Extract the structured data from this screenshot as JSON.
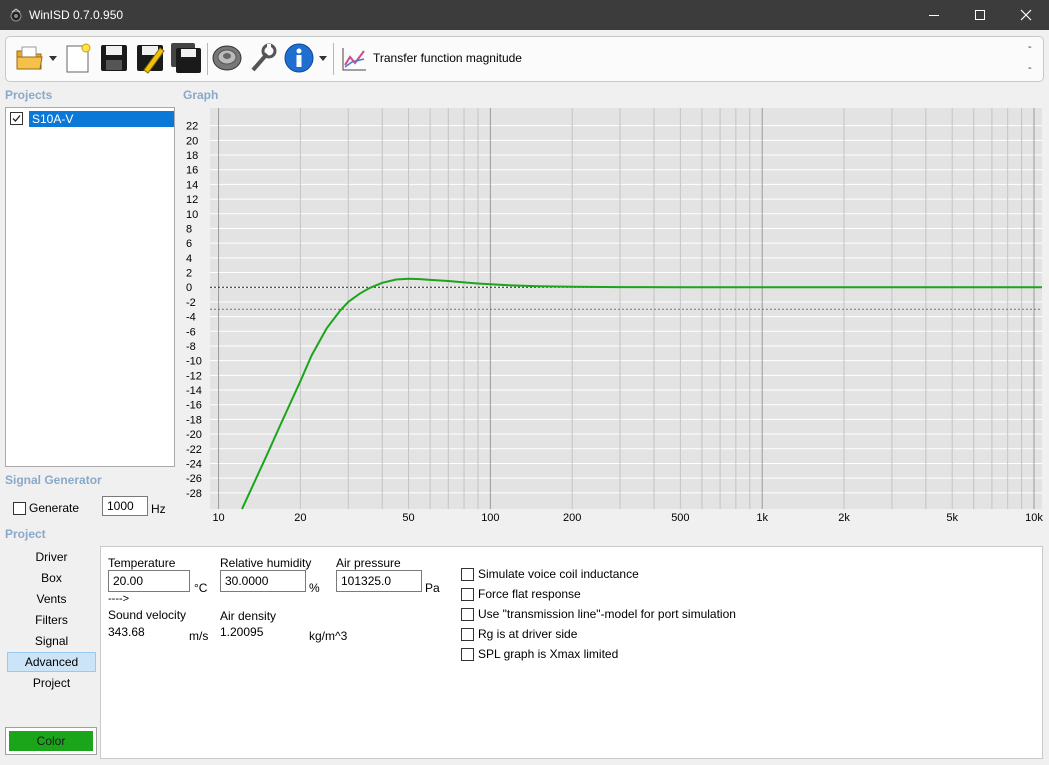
{
  "window": {
    "title": "WinISD 0.7.0.950"
  },
  "toolbar": {
    "icons": [
      "open-folder-icon",
      "new-document-icon",
      "save-icon",
      "edit-icon",
      "save-all-icon",
      "speaker-icon",
      "tools-icon",
      "info-icon"
    ],
    "graph_title": "Transfer function magnitude",
    "dash_top": "-",
    "dash_bottom": "-"
  },
  "projects": {
    "label": "Projects",
    "items": [
      {
        "name": "S10A-V",
        "checked": true
      }
    ]
  },
  "graph_label": "Graph",
  "signal_generator": {
    "label": "Signal Generator",
    "generate_label": "Generate",
    "frequency": "1000",
    "unit": "Hz"
  },
  "project_section": {
    "label": "Project",
    "nav": [
      "Driver",
      "Box",
      "Vents",
      "Filters",
      "Signal",
      "Advanced",
      "Project"
    ],
    "selected": "Advanced",
    "color_button": "Color",
    "color_swatch": "#1aa51a"
  },
  "advanced": {
    "temperature": {
      "label": "Temperature",
      "value": "20.00",
      "unit": "°C"
    },
    "humidity": {
      "label": "Relative humidity",
      "value": "30.0000",
      "unit": "%"
    },
    "pressure": {
      "label": "Air pressure",
      "value": "101325.0",
      "unit": "Pa"
    },
    "arrow": "---->",
    "sound_velocity": {
      "label": "Sound velocity",
      "value": "343.68",
      "unit": "m/s"
    },
    "air_density": {
      "label": "Air density",
      "value": "1.20095",
      "unit": "kg/m^3"
    },
    "options": [
      {
        "label": "Simulate voice coil inductance",
        "checked": false
      },
      {
        "label": "Force flat response",
        "checked": false
      },
      {
        "label": "Use \"transmission line\"-model for port simulation",
        "checked": false
      },
      {
        "label": "Rg is at driver side",
        "checked": false
      },
      {
        "label": "SPL graph is Xmax limited",
        "checked": false
      }
    ]
  },
  "chart_data": {
    "type": "line",
    "title": "Transfer function magnitude",
    "x_scale": "log",
    "xlim": [
      9.3,
      10700
    ],
    "ylim": [
      -30.2,
      24.4
    ],
    "x_ticks": [
      {
        "v": 10,
        "label": "10"
      },
      {
        "v": 20,
        "label": "20"
      },
      {
        "v": 50,
        "label": "50"
      },
      {
        "v": 100,
        "label": "100"
      },
      {
        "v": 200,
        "label": "200"
      },
      {
        "v": 500,
        "label": "500"
      },
      {
        "v": 1000,
        "label": "1k"
      },
      {
        "v": 2000,
        "label": "2k"
      },
      {
        "v": 5000,
        "label": "5k"
      },
      {
        "v": 10000,
        "label": "10k"
      }
    ],
    "y_ticks": [
      22,
      20,
      18,
      16,
      14,
      12,
      10,
      8,
      6,
      4,
      2,
      0,
      -2,
      -4,
      -6,
      -8,
      -10,
      -12,
      -14,
      -16,
      -18,
      -20,
      -22,
      -24,
      -26,
      -28
    ],
    "reference_lines": [
      0,
      -3
    ],
    "grid": true,
    "series": [
      {
        "color": "#1aa51a",
        "x": [
          12.2,
          13,
          15,
          17,
          20,
          22,
          25,
          28,
          30,
          33,
          36,
          40,
          45,
          50,
          55,
          60,
          70,
          80,
          90,
          100,
          120,
          150,
          200,
          300,
          500,
          1000,
          2000,
          5000,
          10000,
          10700
        ],
        "y": [
          -30.2,
          -28.0,
          -23.0,
          -18.5,
          -12.8,
          -9.3,
          -5.6,
          -3.2,
          -2.0,
          -0.9,
          -0.1,
          0.6,
          1.05,
          1.15,
          1.1,
          1.0,
          0.85,
          0.65,
          0.5,
          0.4,
          0.25,
          0.12,
          0.05,
          0.01,
          0,
          0,
          0,
          0,
          0,
          0
        ]
      }
    ]
  }
}
